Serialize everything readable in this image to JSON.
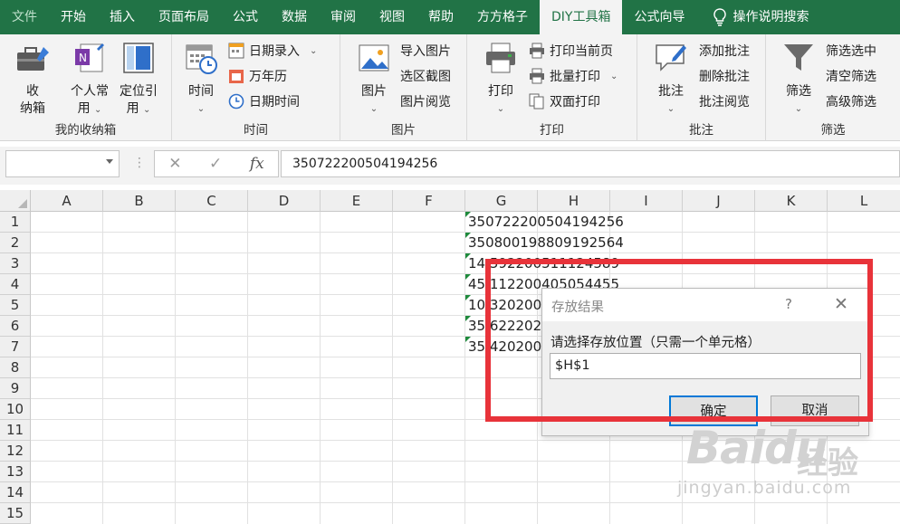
{
  "tabs": [
    {
      "label": "文件",
      "state": "dim"
    },
    {
      "label": "开始",
      "state": ""
    },
    {
      "label": "插入",
      "state": ""
    },
    {
      "label": "页面布局",
      "state": ""
    },
    {
      "label": "公式",
      "state": ""
    },
    {
      "label": "数据",
      "state": ""
    },
    {
      "label": "审阅",
      "state": ""
    },
    {
      "label": "视图",
      "state": ""
    },
    {
      "label": "帮助",
      "state": ""
    },
    {
      "label": "方方格子",
      "state": ""
    },
    {
      "label": "DIY工具箱",
      "state": "active"
    },
    {
      "label": "公式向导",
      "state": ""
    }
  ],
  "help_search": "操作说明搜索",
  "ribbon": {
    "storage": {
      "big1_line1": "收",
      "big1_line2": "纳箱",
      "big2_line1": "个人常",
      "big2_line2": "用",
      "big3_line1": "定位引",
      "big3_line2": "用",
      "label": "我的收纳箱"
    },
    "time": {
      "big_label": "时间",
      "item1": "日期录入",
      "item2": "万年历",
      "item3": "日期时间",
      "label": "时间"
    },
    "picture": {
      "big_label": "图片",
      "item1": "导入图片",
      "item2": "选区截图",
      "item3": "图片阅览",
      "label": "图片"
    },
    "print": {
      "big_label": "打印",
      "item1": "打印当前页",
      "item2": "批量打印",
      "item3": "双面打印",
      "label": "打印"
    },
    "comment": {
      "big_label": "批注",
      "item1": "添加批注",
      "item2": "删除批注",
      "item3": "批注阅览",
      "label": "批注"
    },
    "filter": {
      "big_label": "筛选",
      "item1": "筛选选中",
      "item2": "清空筛选",
      "item3": "高级筛选",
      "label": "筛选"
    }
  },
  "formula_bar": {
    "name_box": "",
    "cancel_symbol": "✕",
    "enter_symbol": "✓",
    "fx_symbol": "fx",
    "value": "350722200504194256"
  },
  "columns": [
    "A",
    "B",
    "C",
    "D",
    "E",
    "F",
    "G",
    "H",
    "I",
    "J",
    "K",
    "L"
  ],
  "rows": [
    "1",
    "2",
    "3",
    "4",
    "5",
    "6",
    "7",
    "8",
    "9",
    "10",
    "11",
    "12",
    "13",
    "14",
    "15"
  ],
  "cells_g": [
    "350722200504194256",
    "350800198809192564",
    "14 592200511124589",
    "45 112200405054455",
    "10 320200",
    "35 622202",
    "35 420200"
  ],
  "dialog": {
    "title": "存放结果",
    "help": "?",
    "close": "✕",
    "prompt": "请选择存放位置（只需一个单元格）",
    "value": "$H$1",
    "ok": "确定",
    "cancel": "取消"
  },
  "watermark": {
    "logo": "Baidu",
    "cn": "经验",
    "url": "jingyan.baidu.com"
  },
  "colors": {
    "excel_green": "#217346",
    "highlight_red": "#e8333a",
    "dialog_focus": "#0078d7"
  }
}
